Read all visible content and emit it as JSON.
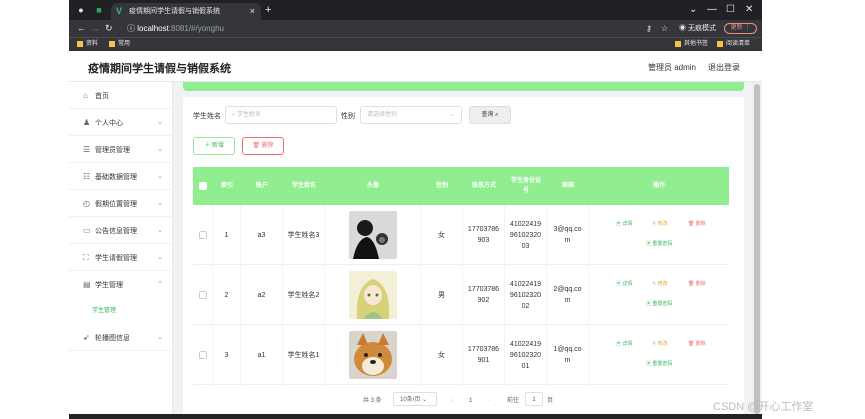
{
  "browser": {
    "tab_title": "疫情期间学生请假与销假系统",
    "tab_close": "×",
    "new_tab": "+",
    "url_host": "localhost",
    "url_path": ":8081/#/yonghu",
    "incognito_label": "无痕模式",
    "update_label": "更新 ⋮",
    "bookmarks": [
      "资料",
      "常用"
    ],
    "bookmarks_right": [
      "其他书签",
      "阅读清单"
    ],
    "window_controls": [
      "⌄",
      "—",
      "☐",
      "✕"
    ]
  },
  "app": {
    "title": "疫情期间学生请假与销假系统",
    "admin_label": "管理员 admin",
    "logout_label": "退出登录"
  },
  "sidebar": {
    "items": [
      {
        "label": "首页",
        "icon": "home-icon",
        "glyph": "⌂",
        "has_chevron": false
      },
      {
        "label": "个人中心",
        "icon": "user-icon",
        "glyph": "♟",
        "has_chevron": true
      },
      {
        "label": "管理员管理",
        "icon": "list-icon",
        "glyph": "☰",
        "has_chevron": true
      },
      {
        "label": "基础数据管理",
        "icon": "sliders-icon",
        "glyph": "☷",
        "has_chevron": true
      },
      {
        "label": "假期位置管理",
        "icon": "clock-icon",
        "glyph": "◴",
        "has_chevron": true
      },
      {
        "label": "公告信息管理",
        "icon": "chat-icon",
        "glyph": "▭",
        "has_chevron": true
      },
      {
        "label": "学生请假管理",
        "icon": "frame-icon",
        "glyph": "⛶",
        "has_chevron": true
      },
      {
        "label": "学生管理",
        "icon": "document-icon",
        "glyph": "▤",
        "has_chevron": true,
        "expanded": true
      },
      {
        "label": "轮播图信息",
        "icon": "send-icon",
        "glyph": "➹",
        "has_chevron": true
      }
    ],
    "sub_item": "学生管理",
    "chevron": "⌄",
    "chevron_up": "⌃"
  },
  "search": {
    "name_label": "学生姓名",
    "name_placeholder": "学生姓名",
    "gender_label": "性别",
    "gender_placeholder": "请选择性别",
    "query_button": "查询",
    "add_button": "新增",
    "delete_button": "删除"
  },
  "table": {
    "columns": [
      "",
      "索引",
      "账户",
      "学生姓名",
      "头像",
      "性别",
      "联系方式",
      "学生身份证号",
      "邮箱",
      "操作"
    ],
    "rows": [
      {
        "index": "1",
        "account": "a3",
        "name": "学生姓名3",
        "gender": "女",
        "phone": "17703786903",
        "id_card": "410224199610232003",
        "email": "3@qq.com",
        "avatar": "person-with-dog"
      },
      {
        "index": "2",
        "account": "a2",
        "name": "学生姓名2",
        "gender": "男",
        "phone": "17703786902",
        "id_card": "410224199610232002",
        "email": "2@qq.com",
        "avatar": "anime-girl"
      },
      {
        "index": "3",
        "account": "a1",
        "name": "学生姓名1",
        "gender": "女",
        "phone": "17703786901",
        "id_card": "410224199610232001",
        "email": "1@qq.com",
        "avatar": "shiba-dog"
      }
    ],
    "actions": {
      "detail": "详情",
      "edit": "修改",
      "delete": "删除",
      "reset_password": "重置密码"
    }
  },
  "pagination": {
    "total": "共 3 条",
    "page_size": "10条/页",
    "prev": "‹",
    "current": "1",
    "next": "›",
    "goto_label": "前往",
    "goto_value": "1",
    "page_suffix": "页"
  },
  "colors": {
    "accent_green": "#90ee90",
    "sub_item_green": "#3eb65a",
    "delete_red": "#f56c6c"
  },
  "watermark": "CSDN @开心工作室"
}
